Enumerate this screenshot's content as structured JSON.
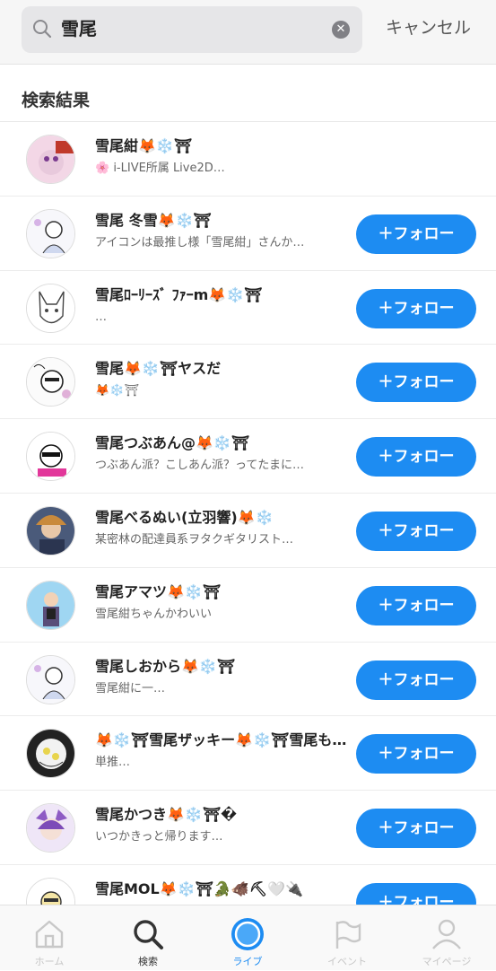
{
  "search": {
    "query": "雪尾",
    "cancel_label": "キャンセル"
  },
  "section_title": "検索結果",
  "follow_label": "＋フォロー",
  "results": [
    {
      "name": "雪尾紺🦊❄️⛩",
      "sub": "🌸 i-LIVE所属 Live2D…",
      "following": true
    },
    {
      "name": "雪尾 冬雪🦊❄️⛩",
      "sub": "アイコンは最推し様「雪尾紺」さんか…",
      "following": false
    },
    {
      "name": "雪尾ﾛｰﾘｰｽﾞ ﾌｧｰm🦊❄️⛩",
      "sub": "…",
      "following": false
    },
    {
      "name": "雪尾🦊❄️⛩ヤスだ",
      "sub": "🦊❄️⛩",
      "following": false
    },
    {
      "name": "雪尾つぶあん@🦊❄️⛩",
      "sub": "つぶあん派？こしあん派？ってたまに…",
      "following": false
    },
    {
      "name": "雪尾べるぬい(立羽響)🦊❄️",
      "sub": "某密林の配達員系ヲタクギタリスト…",
      "following": false
    },
    {
      "name": "雪尾アマツ🦊❄️⛩",
      "sub": "雪尾紺ちゃんかわいい",
      "following": false
    },
    {
      "name": "雪尾しおから🦊❄️⛩",
      "sub": "雪尾紺に一…",
      "following": false
    },
    {
      "name": "🦊❄️⛩雪尾ザッキー🦊❄️⛩雪尾もも…",
      "sub": "単推…",
      "following": false
    },
    {
      "name": "雪尾かつき🦊❄️⛩�",
      "sub": "いつかきっと帰ります…",
      "following": false
    },
    {
      "name": "雪尾MOL🦊❄️⛩🐊🐗⛏🤍🔌",
      "sub": "",
      "following": false
    }
  ],
  "tabs": [
    {
      "label": "ホーム",
      "icon": "home-icon"
    },
    {
      "label": "検索",
      "icon": "search-icon"
    },
    {
      "label": "ライブ",
      "icon": "live-icon"
    },
    {
      "label": "イベント",
      "icon": "event-flag-icon"
    },
    {
      "label": "マイページ",
      "icon": "person-icon"
    }
  ],
  "colors": {
    "accent": "#1d8cf2",
    "text": "#222222",
    "subtext": "#666666"
  }
}
